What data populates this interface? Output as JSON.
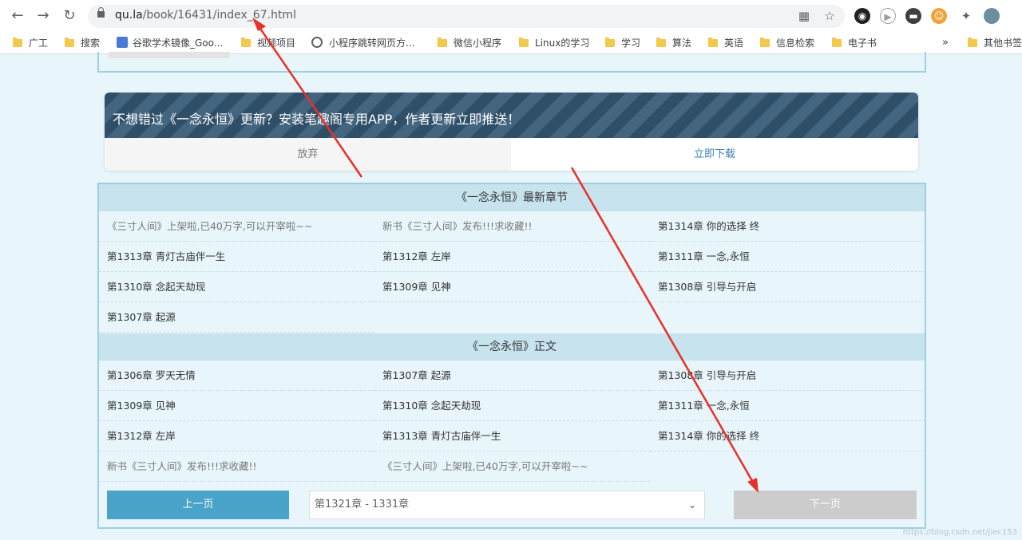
{
  "browser": {
    "url_host": "qu.la",
    "url_path": "/book/16431/index_67.html",
    "bookmarks": [
      {
        "label": "广工",
        "icon": "folder-icon"
      },
      {
        "label": "搜索",
        "icon": "folder-icon"
      },
      {
        "label": "谷歌学术镜像_Goo...",
        "icon": "google-scholar-icon"
      },
      {
        "label": "视频项目",
        "icon": "folder-icon"
      },
      {
        "label": "小程序跳转网页方...",
        "icon": "globe-icon"
      },
      {
        "label": "微信小程序",
        "icon": "folder-icon"
      },
      {
        "label": "Linux的学习",
        "icon": "folder-icon"
      },
      {
        "label": "学习",
        "icon": "folder-icon"
      },
      {
        "label": "算法",
        "icon": "folder-icon"
      },
      {
        "label": "英语",
        "icon": "folder-icon"
      },
      {
        "label": "信息检索",
        "icon": "folder-icon"
      },
      {
        "label": "电子书",
        "icon": "folder-icon"
      }
    ],
    "bookmarks_overflow": "»",
    "other_bookmarks": "其他书签"
  },
  "promo": {
    "text": "不想错过《一念永恒》更新？安装笔趣阁专用APP，作者更新立即推送！",
    "dismiss_label": "放弃",
    "download_label": "立即下载"
  },
  "latest": {
    "title": "《一念永恒》最新章节",
    "rows": [
      [
        "《三寸人间》上架啦,已40万字,可以开宰啦~~",
        "新书《三寸人间》发布!!!求收藏!!",
        "第1314章 你的选择 终"
      ],
      [
        "第1313章 青灯古庙伴一生",
        "第1312章 左岸",
        "第1311章 一念,永恒"
      ],
      [
        "第1310章 念起天劫现",
        "第1309章 见神",
        "第1308章 引导与开启"
      ],
      [
        "第1307章 起源",
        "",
        ""
      ]
    ]
  },
  "main": {
    "title": "《一念永恒》正文",
    "rows": [
      [
        "第1306章 罗天无情",
        "第1307章 起源",
        "第1308章 引导与开启"
      ],
      [
        "第1309章 见神",
        "第1310章 念起天劫现",
        "第1311章 一念,永恒"
      ],
      [
        "第1312章 左岸",
        "第1313章 青灯古庙伴一生",
        "第1314章 你的选择 终"
      ],
      [
        "新书《三寸人间》发布!!!求收藏!!",
        "《三寸人间》上架啦,已40万字,可以开宰啦~~",
        ""
      ]
    ]
  },
  "pager": {
    "prev_label": "上一页",
    "select_value": "第1321章 - 1331章",
    "next_label": "下一页"
  },
  "watermark": "https://blog.csdn.net/jiec153",
  "colors": {
    "page_bg": "#e8f6fb",
    "section_header": "#c7e3ee",
    "border": "#9ecfe0",
    "prev_button": "#4aa3c8",
    "next_button_disabled": "#cccccc",
    "promo_header": "#2f4f68",
    "annotation_arrow": "#e8302a"
  }
}
